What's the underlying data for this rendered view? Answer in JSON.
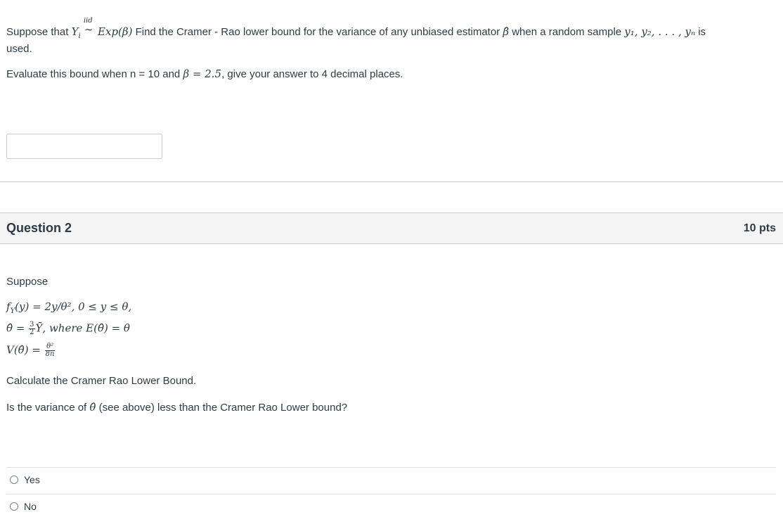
{
  "question1": {
    "text_suppose": "Suppose that ",
    "math_Yi": "Y",
    "math_sub_i": "i",
    "iid_label": "iid",
    "tilde": "∼",
    "math_dist": "Exp(β)",
    "text_find": " Find the Cramer - Rao lower bound for the variance of any unbiased estimator ",
    "math_beta_hat": "β̂",
    "text_when": " when a random sample ",
    "math_sample": "y₁, y₂, . . . , yₙ",
    "text_is": " is",
    "text_used": "used.",
    "eval_before": "Evaluate this bound when n = 10 and ",
    "eval_math": "β = 2.5",
    "eval_after": ", give your answer to 4 decimal places.",
    "answer_value": "",
    "answer_placeholder": ""
  },
  "question2": {
    "title": "Question 2",
    "points": "10 pts",
    "suppose": "Suppose",
    "eq1": "f",
    "eq1_sub": "Y",
    "eq1_rest": "(y) = 2y/θ², 0 ≤ y ≤ θ,",
    "eq2_left": "θ̂ = ",
    "eq2_num": "3",
    "eq2_den": "2",
    "eq2_right": "Ȳ, where E(θ̂) = θ",
    "eq3_left": "V(θ̂) = ",
    "eq3_num": "θ²",
    "eq3_den": "8n",
    "calc": "Calculate the Cramer Rao Lower Bound.",
    "ask_before": "Is the variance of ",
    "ask_math": "θ̂",
    "ask_after": " (see above) less than the Cramer Rao Lower bound?",
    "options": [
      {
        "label": "Yes"
      },
      {
        "label": "No"
      }
    ]
  }
}
